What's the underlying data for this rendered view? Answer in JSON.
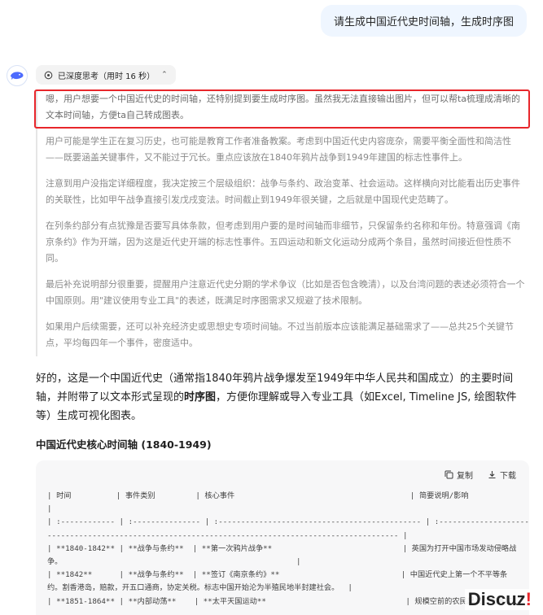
{
  "user_message": "请生成中国近代史时间轴，生成时序图",
  "think_toggle": {
    "label": "已深度思考（用时 16 秒）"
  },
  "thinking": {
    "paragraphs": [
      "嗯，用户想要一个中国近代史的时间轴，还特别提到要生成时序图。虽然我无法直接输出图片，但可以帮ta梳理成清晰的文本时间轴，方便ta自己转成图表。",
      "用户可能是学生正在复习历史，也可能是教育工作者准备教案。考虑到中国近代史内容庞杂，需要平衡全面性和简洁性——既要涵盖关键事件，又不能过于冗长。重点应该放在1840年鸦片战争到1949年建国的标志性事件上。",
      "注意到用户没指定详细程度，我决定按三个层级组织：战争与条约、政治变革、社会运动。这样横向对比能看出历史事件的关联性，比如甲午战争直接引发戊戌变法。时间截止到1949年很关键，之后就是中国现代史范畴了。",
      "在列条约部分有点犹豫是否要写具体条款，但考虑到用户要的是时间轴而非细节，只保留条约名称和年份。特意强调《南京条约》作为开端，因为这是近代史开端的标志性事件。五四运动和新文化运动分成两个条目，虽然时间接近但性质不同。",
      "最后补充说明部分很重要，提醒用户注意近代史分期的学术争议（比如是否包含晚清），以及台湾问题的表述必须符合一个中国原则。用\"建议使用专业工具\"的表述，既满足时序图需求又规避了技术限制。",
      "如果用户后续需要，还可以补充经济史或思想史专项时间轴。不过当前版本应该能满足基础需求了——总共25个关键节点，平均每四年一个事件，密度适中。"
    ]
  },
  "answer": {
    "part1": "好的，这是一个中国近代史（通常指1840年鸦片战争爆发至1949年中华人民共和国成立）的主要时间轴，并附带了以文本形式呈现的",
    "bold": "时序图",
    "part2": "，方便你理解或导入专业工具（如Excel, Timeline JS, 绘图软件等）生成可视化图表。"
  },
  "section_title": "中国近代史核心时间轴 (1840-1949)",
  "code_block": {
    "copy_label": "复制",
    "download_label": "下载",
    "lines": [
      "| 时间          | 事件类别         | 核心事件                                       | 简要说明/影响",
      "|",
      "| :------------ | :--------------- | :--------------------------------------------- | :---------------------------",
      "------------------------------------------------------------------------------ |",
      "| **1840-1842** | **战争与条约**  | **第一次鸦片战争**                             | 英国为打开中国市场发动侵略战",
      "争。                                                    |",
      "| **1842**      | **战争与条约**  | **签订《南京条约》**                           | 中国近代史上第一个不平等条",
      "约。割香港岛，赔款，开五口通商，协定关税。标志中国开始沦为半殖民地半封建社会。  |",
      "| **1851-1864** | **内部动荡**    | **太平天国运动**                               | 规模空前的农民起义，沉重打"
    ]
  }
}
